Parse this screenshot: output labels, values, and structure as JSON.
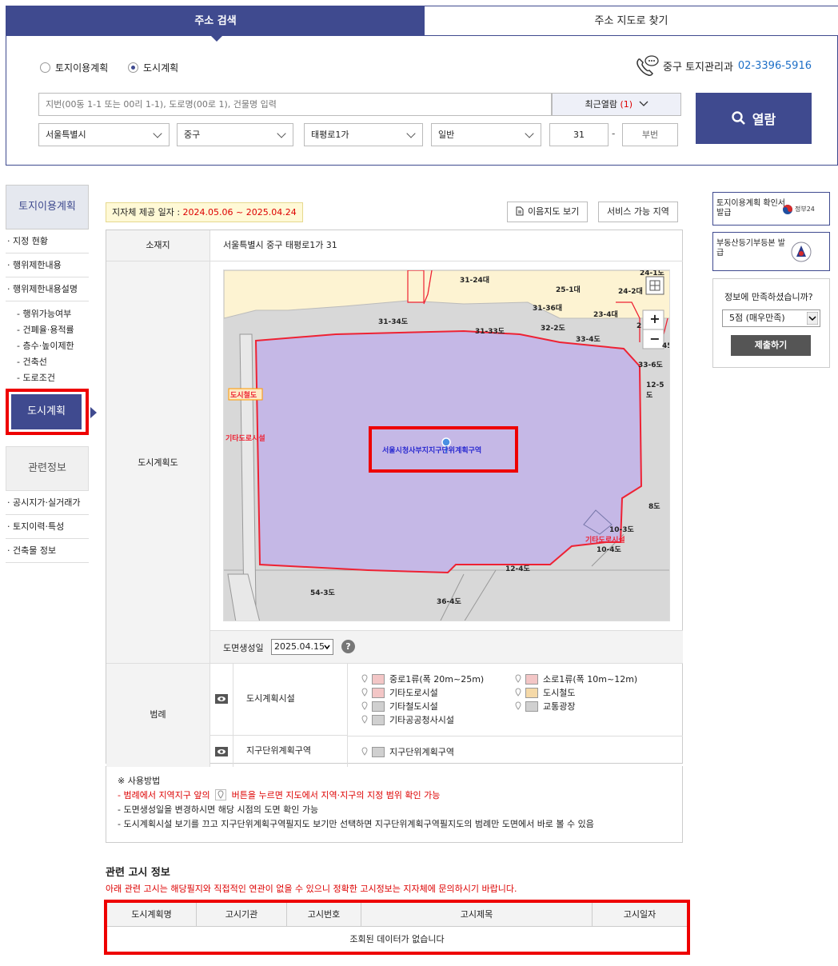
{
  "tabs": {
    "address_search": "주소 검색",
    "map_search": "주소 지도로 찾기"
  },
  "plan_type": {
    "land_use": "토지이용계획",
    "urban": "도시계획"
  },
  "contact": {
    "office": "중구 토지관리과",
    "phone": "02-3396-5916"
  },
  "search": {
    "placeholder": "지번(00동 1-1 또는 00리 1-1), 도로명(00로 1), 건물명 입력",
    "recent_label": "최근열람",
    "recent_count": "(1)",
    "open_button": "열람",
    "city": "서울특별시",
    "district": "중구",
    "dong": "태평로1가",
    "lot_type": "일반",
    "main_no": "31",
    "dash": "-",
    "sub_no_placeholder": "부번"
  },
  "left_nav": {
    "head": "토지이용계획",
    "items": [
      "· 지정 현황",
      "· 행위제한내용",
      "· 행위제한내용설명"
    ],
    "subs": [
      "- 행위가능여부",
      "- 건폐율·용적률",
      "- 층수·높이제한",
      "- 건축선",
      "- 도로조건"
    ],
    "active": "도시계획",
    "head2": "관련정보",
    "items2": [
      "· 공시지가·실거래가",
      "· 토지이력·특성",
      "· 건축물 정보"
    ]
  },
  "provide_date": {
    "label": "지자체 제공 일자 : ",
    "range": "2024.05.06 ~ 2025.04.24"
  },
  "buttons": {
    "print_map": "이음지도 보기",
    "service_area": "서비스 가능 지역"
  },
  "location": {
    "label": "소재지",
    "value": "서울특별시 중구 태평로1가 31"
  },
  "map_section": {
    "label": "도시계획도",
    "plan_area": "서울시청사부지지구단위계획구역",
    "labels": {
      "l1": "31-24대",
      "l2": "25-1대",
      "l3": "24-2대",
      "l4": "31-36대",
      "l5": "23-4대",
      "l6": "31-34도",
      "l7": "31-33도",
      "l8": "32-2도",
      "l9": "33-4도",
      "l10": "33-6도",
      "l11": "12-5도",
      "l12": "도시철도",
      "l13": "기타도로시설",
      "l14": "8도",
      "l15": "10-3도",
      "l16": "기타도로시설",
      "l17": "10-4도",
      "l18": "12-4도",
      "l19": "54-3도",
      "l20": "36-4도",
      "l21": "24-1도",
      "l22": "2",
      "l23": "45"
    },
    "zoom_in": "+",
    "zoom_out": "−",
    "date_label": "도면생성일",
    "date_value": "2025.04.15",
    "help": "?"
  },
  "legend": {
    "label": "범례",
    "group1": "도시계획시설",
    "group1_items": [
      {
        "name": "중로1류(폭 20m~25m)",
        "color": "#f3c6c6"
      },
      {
        "name": "소로1류(폭 10m~12m)",
        "color": "#f3c6c6"
      },
      {
        "name": "기타도로시설",
        "color": "#f3c6c6"
      },
      {
        "name": "도시철도",
        "color": "#f5d9a8"
      },
      {
        "name": "기타철도시설",
        "color": "#d0d0d0"
      },
      {
        "name": "교통광장",
        "color": "#d0d0d0"
      },
      {
        "name": "기타공공청사시설",
        "color": "#d0d0d0"
      }
    ],
    "group2": "지구단위계획구역",
    "group2_items": [
      {
        "name": "지구단위계획구역",
        "color": "#d0d0d0"
      }
    ]
  },
  "usage": {
    "title": "※ 사용방법",
    "line1a": "- 범례에서 지역지구 앞의",
    "line1b": "버튼을 누르면 지도에서 지역·지구의 지정 범위 확인 가능",
    "line2": "- 도면생성일을 변경하시면 해당 시점의 도면 확인 가능",
    "line3": "- 도시계획시설 보기를 끄고 지구단위계획구역필지도 보기만 선택하면 지구단위계획구역필지도의 범례만 도면에서 바로 볼 수 있음"
  },
  "notice": {
    "title": "관련 고시 정보",
    "warn": "아래 관련 고시는 해당필지와 직접적인 연관이 없을 수 있으니 정확한 고시정보는 지자체에 문의하시기 바랍니다.",
    "columns": [
      "도시계획명",
      "고시기관",
      "고시번호",
      "고시제목",
      "고시일자"
    ],
    "empty": "조회된 데이터가 없습니다"
  },
  "right": {
    "box1": "토지이용계획 확인서 발급",
    "box1_logo": "정부24",
    "box2": "부동산등기부등본 발급",
    "survey_q": "정보에 만족하셨습니까?",
    "survey_value": "5점 (매우만족)",
    "submit": "제출하기"
  }
}
